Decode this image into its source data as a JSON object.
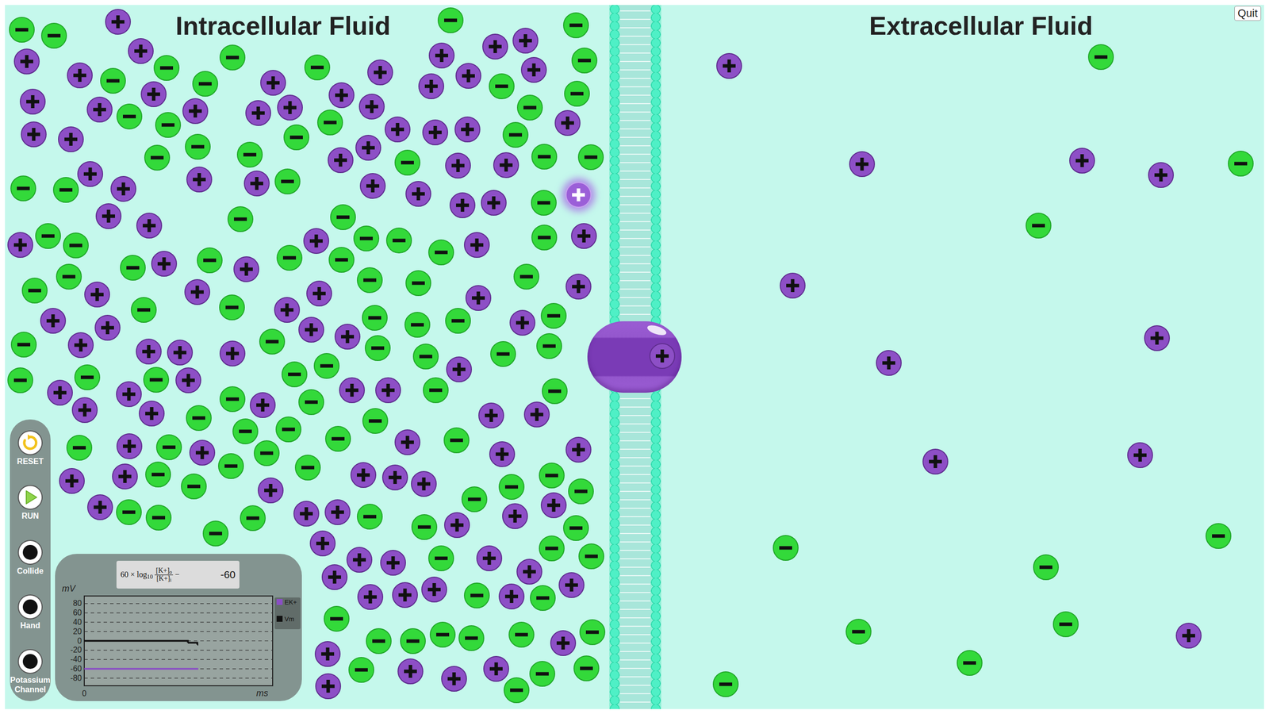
{
  "regions": [
    {
      "title": "Intracellular Fluid"
    },
    {
      "title": "Extracellular Fluid"
    }
  ],
  "quit_button": "Quit",
  "channel": {
    "occupied": true
  },
  "intracellular_ions": [
    {
      "kind": "cation",
      "highlighted": true
    },
    {
      "kind": "cation",
      "highlighted": false
    },
    {
      "kind": "anion",
      "highlighted": false
    },
    {
      "kind": "cation",
      "highlighted": false
    },
    {
      "kind": "anion",
      "highlighted": false
    },
    {
      "kind": "cation",
      "highlighted": false
    },
    {
      "kind": "anion",
      "highlighted": false
    },
    {
      "kind": "cation",
      "highlighted": false
    },
    {
      "kind": "anion",
      "highlighted": false
    },
    {
      "kind": "cation",
      "highlighted": false
    },
    {
      "kind": "anion",
      "highlighted": false
    },
    {
      "kind": "cation",
      "highlighted": false
    },
    {
      "kind": "anion",
      "highlighted": false
    },
    {
      "kind": "cation",
      "highlighted": false
    },
    {
      "kind": "anion",
      "highlighted": false
    },
    {
      "kind": "cation",
      "highlighted": false
    },
    {
      "kind": "anion",
      "highlighted": false
    },
    {
      "kind": "cation",
      "highlighted": false
    },
    {
      "kind": "anion",
      "highlighted": false
    },
    {
      "kind": "cation",
      "highlighted": false
    },
    {
      "kind": "anion",
      "highlighted": false
    },
    {
      "kind": "cation",
      "highlighted": false
    },
    {
      "kind": "anion",
      "highlighted": false
    },
    {
      "kind": "cation",
      "highlighted": false
    },
    {
      "kind": "anion",
      "highlighted": false
    },
    {
      "kind": "cation",
      "highlighted": false
    },
    {
      "kind": "anion",
      "highlighted": false
    },
    {
      "kind": "cation",
      "highlighted": false
    },
    {
      "kind": "anion",
      "highlighted": false
    },
    {
      "kind": "cation",
      "highlighted": false
    },
    {
      "kind": "anion",
      "highlighted": false
    },
    {
      "kind": "cation",
      "highlighted": false
    },
    {
      "kind": "anion",
      "highlighted": false
    },
    {
      "kind": "cation",
      "highlighted": false
    },
    {
      "kind": "anion",
      "highlighted": false
    },
    {
      "kind": "cation",
      "highlighted": false
    },
    {
      "kind": "anion",
      "highlighted": false
    },
    {
      "kind": "cation",
      "highlighted": false
    },
    {
      "kind": "anion",
      "highlighted": false
    },
    {
      "kind": "cation",
      "highlighted": false
    },
    {
      "kind": "anion",
      "highlighted": false
    },
    {
      "kind": "cation",
      "highlighted": false
    },
    {
      "kind": "anion",
      "highlighted": false
    },
    {
      "kind": "cation",
      "highlighted": false
    },
    {
      "kind": "anion",
      "highlighted": false
    },
    {
      "kind": "cation",
      "highlighted": false
    },
    {
      "kind": "anion",
      "highlighted": false
    },
    {
      "kind": "cation",
      "highlighted": false
    },
    {
      "kind": "anion",
      "highlighted": false
    },
    {
      "kind": "cation",
      "highlighted": false
    },
    {
      "kind": "anion",
      "highlighted": false
    },
    {
      "kind": "cation",
      "highlighted": false
    },
    {
      "kind": "anion",
      "highlighted": false
    },
    {
      "kind": "cation",
      "highlighted": false
    },
    {
      "kind": "anion",
      "highlighted": false
    },
    {
      "kind": "cation",
      "highlighted": false
    },
    {
      "kind": "anion",
      "highlighted": false
    },
    {
      "kind": "cation",
      "highlighted": false
    },
    {
      "kind": "anion",
      "highlighted": false
    },
    {
      "kind": "cation",
      "highlighted": false
    },
    {
      "kind": "anion",
      "highlighted": false
    },
    {
      "kind": "cation",
      "highlighted": false
    },
    {
      "kind": "anion",
      "highlighted": false
    },
    {
      "kind": "cation",
      "highlighted": false
    },
    {
      "kind": "anion",
      "highlighted": false
    },
    {
      "kind": "cation",
      "highlighted": false
    },
    {
      "kind": "anion",
      "highlighted": false
    },
    {
      "kind": "cation",
      "highlighted": false
    },
    {
      "kind": "anion",
      "highlighted": false
    },
    {
      "kind": "cation",
      "highlighted": false
    },
    {
      "kind": "anion",
      "highlighted": false
    },
    {
      "kind": "cation",
      "highlighted": false
    },
    {
      "kind": "anion",
      "highlighted": false
    },
    {
      "kind": "cation",
      "highlighted": false
    },
    {
      "kind": "anion",
      "highlighted": false
    },
    {
      "kind": "cation",
      "highlighted": false
    },
    {
      "kind": "anion",
      "highlighted": false
    },
    {
      "kind": "cation",
      "highlighted": false
    },
    {
      "kind": "anion",
      "highlighted": false
    },
    {
      "kind": "cation",
      "highlighted": false
    },
    {
      "kind": "anion",
      "highlighted": false
    },
    {
      "kind": "cation",
      "highlighted": false
    },
    {
      "kind": "anion",
      "highlighted": false
    },
    {
      "kind": "cation",
      "highlighted": false
    },
    {
      "kind": "anion",
      "highlighted": false
    },
    {
      "kind": "cation",
      "highlighted": false
    },
    {
      "kind": "anion",
      "highlighted": false
    },
    {
      "kind": "cation",
      "highlighted": false
    },
    {
      "kind": "anion",
      "highlighted": false
    },
    {
      "kind": "cation",
      "highlighted": false
    },
    {
      "kind": "anion",
      "highlighted": false
    },
    {
      "kind": "cation",
      "highlighted": false
    },
    {
      "kind": "anion",
      "highlighted": false
    },
    {
      "kind": "cation",
      "highlighted": false
    },
    {
      "kind": "anion",
      "highlighted": false
    },
    {
      "kind": "cation",
      "highlighted": false
    },
    {
      "kind": "anion",
      "highlighted": false
    },
    {
      "kind": "cation",
      "highlighted": false
    },
    {
      "kind": "anion",
      "highlighted": false
    },
    {
      "kind": "cation",
      "highlighted": false
    },
    {
      "kind": "anion",
      "highlighted": false
    },
    {
      "kind": "cation",
      "highlighted": false
    },
    {
      "kind": "anion",
      "highlighted": false
    },
    {
      "kind": "cation",
      "highlighted": false
    },
    {
      "kind": "anion",
      "highlighted": false
    },
    {
      "kind": "cation",
      "highlighted": false
    },
    {
      "kind": "anion",
      "highlighted": false
    },
    {
      "kind": "cation",
      "highlighted": false
    },
    {
      "kind": "anion",
      "highlighted": false
    },
    {
      "kind": "cation",
      "highlighted": false
    },
    {
      "kind": "anion",
      "highlighted": false
    },
    {
      "kind": "cation",
      "highlighted": false
    },
    {
      "kind": "anion",
      "highlighted": false
    },
    {
      "kind": "cation",
      "highlighted": false
    },
    {
      "kind": "anion",
      "highlighted": false
    },
    {
      "kind": "cation",
      "highlighted": false
    },
    {
      "kind": "anion",
      "highlighted": false
    },
    {
      "kind": "cation",
      "highlighted": false
    },
    {
      "kind": "anion",
      "highlighted": false
    },
    {
      "kind": "cation",
      "highlighted": false
    },
    {
      "kind": "anion",
      "highlighted": false
    },
    {
      "kind": "cation",
      "highlighted": false
    },
    {
      "kind": "anion",
      "highlighted": false
    },
    {
      "kind": "cation",
      "highlighted": false
    },
    {
      "kind": "anion",
      "highlighted": false
    },
    {
      "kind": "cation",
      "highlighted": false
    },
    {
      "kind": "anion",
      "highlighted": false
    },
    {
      "kind": "cation",
      "highlighted": false
    },
    {
      "kind": "anion",
      "highlighted": false
    },
    {
      "kind": "cation",
      "highlighted": false
    },
    {
      "kind": "anion",
      "highlighted": false
    },
    {
      "kind": "cation",
      "highlighted": false
    },
    {
      "kind": "anion",
      "highlighted": false
    },
    {
      "kind": "cation",
      "highlighted": false
    },
    {
      "kind": "anion",
      "highlighted": false
    },
    {
      "kind": "cation",
      "highlighted": false
    },
    {
      "kind": "anion",
      "highlighted": false
    },
    {
      "kind": "cation",
      "highlighted": false
    },
    {
      "kind": "anion",
      "highlighted": false
    },
    {
      "kind": "cation",
      "highlighted": false
    },
    {
      "kind": "anion",
      "highlighted": false
    },
    {
      "kind": "cation",
      "highlighted": false
    },
    {
      "kind": "anion",
      "highlighted": false
    },
    {
      "kind": "cation",
      "highlighted": false
    },
    {
      "kind": "anion",
      "highlighted": false
    },
    {
      "kind": "cation",
      "highlighted": false
    },
    {
      "kind": "anion",
      "highlighted": false
    },
    {
      "kind": "cation",
      "highlighted": false
    },
    {
      "kind": "anion",
      "highlighted": false
    },
    {
      "kind": "cation",
      "highlighted": false
    },
    {
      "kind": "anion",
      "highlighted": false
    },
    {
      "kind": "cation",
      "highlighted": false
    },
    {
      "kind": "anion",
      "highlighted": false
    },
    {
      "kind": "cation",
      "highlighted": false
    },
    {
      "kind": "anion",
      "highlighted": false
    },
    {
      "kind": "cation",
      "highlighted": false
    },
    {
      "kind": "anion",
      "highlighted": false
    },
    {
      "kind": "cation",
      "highlighted": false
    },
    {
      "kind": "anion",
      "highlighted": false
    },
    {
      "kind": "cation",
      "highlighted": false
    },
    {
      "kind": "anion",
      "highlighted": false
    },
    {
      "kind": "cation",
      "highlighted": false
    },
    {
      "kind": "anion",
      "highlighted": false
    },
    {
      "kind": "cation",
      "highlighted": false
    },
    {
      "kind": "anion",
      "highlighted": false
    },
    {
      "kind": "cation",
      "highlighted": false
    },
    {
      "kind": "anion",
      "highlighted": false
    },
    {
      "kind": "cation",
      "highlighted": false
    },
    {
      "kind": "anion",
      "highlighted": false
    },
    {
      "kind": "cation",
      "highlighted": false
    },
    {
      "kind": "anion",
      "highlighted": false
    },
    {
      "kind": "cation",
      "highlighted": false
    },
    {
      "kind": "anion",
      "highlighted": false
    },
    {
      "kind": "cation",
      "highlighted": false
    },
    {
      "kind": "anion",
      "highlighted": false
    },
    {
      "kind": "cation",
      "highlighted": false
    },
    {
      "kind": "anion",
      "highlighted": false
    },
    {
      "kind": "cation",
      "highlighted": false
    },
    {
      "kind": "anion",
      "highlighted": false
    },
    {
      "kind": "cation",
      "highlighted": false
    },
    {
      "kind": "anion",
      "highlighted": false
    },
    {
      "kind": "cation",
      "highlighted": false
    },
    {
      "kind": "anion",
      "highlighted": false
    },
    {
      "kind": "cation",
      "highlighted": false
    },
    {
      "kind": "anion",
      "highlighted": false
    },
    {
      "kind": "cation",
      "highlighted": false
    },
    {
      "kind": "anion",
      "highlighted": false
    },
    {
      "kind": "cation",
      "highlighted": false
    },
    {
      "kind": "anion",
      "highlighted": false
    },
    {
      "kind": "cation",
      "highlighted": false
    },
    {
      "kind": "anion",
      "highlighted": false
    },
    {
      "kind": "cation",
      "highlighted": false
    },
    {
      "kind": "anion",
      "highlighted": false
    },
    {
      "kind": "cation",
      "highlighted": false
    },
    {
      "kind": "anion",
      "highlighted": false
    },
    {
      "kind": "cation",
      "highlighted": false
    },
    {
      "kind": "anion",
      "highlighted": false
    },
    {
      "kind": "cation",
      "highlighted": false
    },
    {
      "kind": "anion",
      "highlighted": false
    },
    {
      "kind": "cation",
      "highlighted": false
    },
    {
      "kind": "anion",
      "highlighted": false
    },
    {
      "kind": "cation",
      "highlighted": false
    },
    {
      "kind": "anion",
      "highlighted": false
    },
    {
      "kind": "cation",
      "highlighted": false
    },
    {
      "kind": "anion",
      "highlighted": false
    },
    {
      "kind": "cation",
      "highlighted": false
    },
    {
      "kind": "anion",
      "highlighted": false
    },
    {
      "kind": "cation",
      "highlighted": false
    },
    {
      "kind": "anion",
      "highlighted": false
    },
    {
      "kind": "cation",
      "highlighted": false
    },
    {
      "kind": "anion",
      "highlighted": false
    },
    {
      "kind": "cation",
      "highlighted": false
    },
    {
      "kind": "anion",
      "highlighted": false
    }
  ],
  "extracellular_ions": [
    {
      "kind": "cation",
      "highlighted": false
    },
    {
      "kind": "anion",
      "highlighted": false
    },
    {
      "kind": "cation",
      "highlighted": false
    },
    {
      "kind": "anion",
      "highlighted": false
    },
    {
      "kind": "cation",
      "highlighted": false
    },
    {
      "kind": "anion",
      "highlighted": false
    },
    {
      "kind": "cation",
      "highlighted": false
    },
    {
      "kind": "anion",
      "highlighted": false
    },
    {
      "kind": "cation",
      "highlighted": false
    },
    {
      "kind": "anion",
      "highlighted": false
    },
    {
      "kind": "cation",
      "highlighted": false
    },
    {
      "kind": "anion",
      "highlighted": false
    },
    {
      "kind": "cation",
      "highlighted": false
    },
    {
      "kind": "anion",
      "highlighted": false
    },
    {
      "kind": "cation",
      "highlighted": false
    },
    {
      "kind": "anion",
      "highlighted": false
    },
    {
      "kind": "cation",
      "highlighted": false
    },
    {
      "kind": "anion",
      "highlighted": false
    },
    {
      "kind": "cation",
      "highlighted": false
    },
    {
      "kind": "anion",
      "highlighted": false
    }
  ],
  "controls": [
    {
      "label": "RESET",
      "kind": "reset",
      "on": false
    },
    {
      "label": "RUN",
      "kind": "run",
      "on": false
    },
    {
      "label": "Collide",
      "kind": "toggle",
      "on": false
    },
    {
      "label": "Hand",
      "kind": "toggle",
      "on": false
    },
    {
      "label": "Potassium Channel",
      "kind": "toggle",
      "on": false
    }
  ],
  "chart": {
    "formula": {
      "prefix": "60 × log",
      "base": "10",
      "numerator": "[K+]",
      "numerator_sub": "o",
      "denominator": "[K+]",
      "denominator_sub": "i",
      "suffix": "−",
      "value": "-60"
    },
    "y_label": "mV",
    "x_label": "ms",
    "x_start": "0",
    "y_ticks": [
      "80",
      "60",
      "40",
      "20",
      "0",
      "-20",
      "-40",
      "-60",
      "-80"
    ],
    "legend": [
      {
        "label": "EK+",
        "color": "#8a4fc4"
      },
      {
        "label": "Vm",
        "color": "#111111"
      }
    ],
    "series": [
      {
        "name": "EK+",
        "values": [
          -60,
          -60,
          -60,
          -60,
          -60,
          -60,
          -60,
          -60,
          -60,
          -60,
          -60,
          -60,
          -60
        ]
      },
      {
        "name": "Vm",
        "values": [
          0,
          0,
          0,
          0,
          0,
          0,
          0,
          0,
          0,
          0,
          0,
          -4,
          -8
        ]
      }
    ]
  }
}
